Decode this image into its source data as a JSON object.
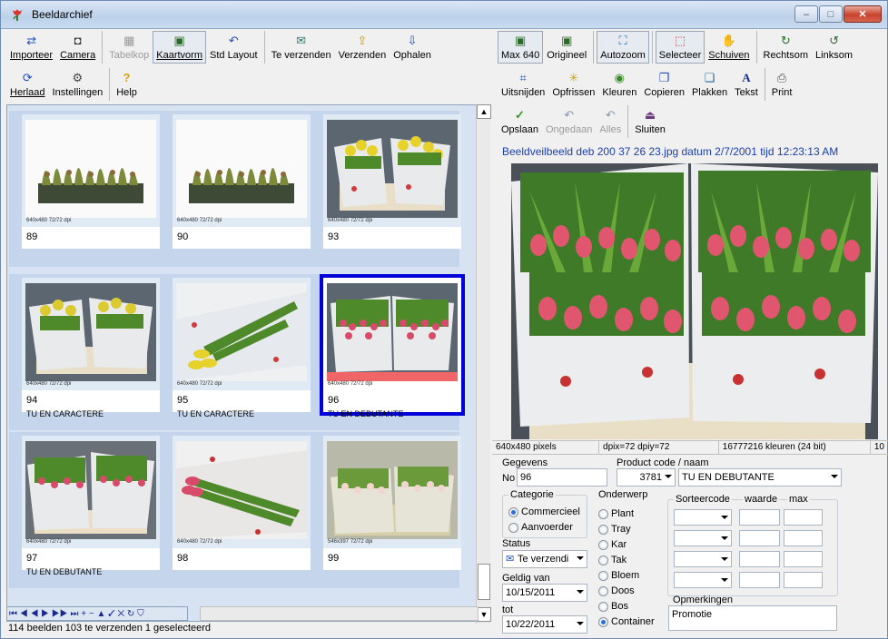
{
  "window": {
    "title": "Beeldarchief",
    "minimize": "–",
    "maximize": "□",
    "close": "✕"
  },
  "left_toolbar_row1": [
    {
      "label": "Importeer",
      "icon": "import-icon",
      "glyph": "⇄"
    },
    {
      "label": "Camera",
      "icon": "camera-icon",
      "glyph": "◘"
    },
    {
      "label": "Tabelkop",
      "icon": "table-icon",
      "glyph": "▦"
    },
    {
      "label": "Kaartvorm",
      "icon": "card-view-icon",
      "glyph": "▣"
    },
    {
      "label": "Std Layout",
      "icon": "undo-layout-icon",
      "glyph": "↶"
    },
    {
      "label": "Te verzenden",
      "icon": "to-send-icon",
      "glyph": "✉"
    },
    {
      "label": "Verzenden",
      "icon": "send-icon",
      "glyph": "⇪"
    },
    {
      "label": "Ophalen",
      "icon": "fetch-icon",
      "glyph": "⇩"
    }
  ],
  "left_toolbar_row2": [
    {
      "label": "Herlaad",
      "icon": "reload-icon",
      "glyph": "⟳"
    },
    {
      "label": "Instellingen",
      "icon": "settings-icon",
      "glyph": "⚙"
    },
    {
      "label": "Help",
      "icon": "help-icon",
      "glyph": "?"
    }
  ],
  "thumbnails": [
    {
      "dim": "640x480 72/72 dpi",
      "num": "89",
      "name": ""
    },
    {
      "dim": "640x480 72/72 dpi",
      "num": "90",
      "name": ""
    },
    {
      "dim": "640x480 72/72 dpi",
      "num": "93",
      "name": ""
    },
    {
      "dim": "640x480 72/72 dpi",
      "num": "94",
      "name": "TU EN CARACTERE"
    },
    {
      "dim": "640x480 72/72 dpi",
      "num": "95",
      "name": "TU EN CARACTERE"
    },
    {
      "dim": "640x480 72/72 dpi",
      "num": "96",
      "name": "TU EN DEBUTANTE"
    },
    {
      "dim": "640x480 72/72 dpi",
      "num": "97",
      "name": "TU EN DEBUTANTE"
    },
    {
      "dim": "640x480 72/72 dpi",
      "num": "98",
      "name": ""
    },
    {
      "dim": "546x397 72/72 dpi",
      "num": "99",
      "name": ""
    }
  ],
  "navigator": {
    "buttons": "⏮ ◀ ◀ ▶ ▶▶ ⏭ + − ▲ ✓ ✕ ↻ ⛉"
  },
  "status_text": "114 beelden  103 te verzenden  1 geselecteerd",
  "right_toolbar_row1": [
    {
      "label": "Max 640",
      "icon": "max-size-icon",
      "glyph": "▣"
    },
    {
      "label": "Origineel",
      "icon": "original-size-icon",
      "glyph": "▣"
    },
    {
      "label": "Autozoom",
      "icon": "autozoom-icon",
      "glyph": "⛶"
    },
    {
      "label": "Selecteer",
      "icon": "select-icon",
      "glyph": "⬚"
    },
    {
      "label": "Schuiven",
      "icon": "hand-icon",
      "glyph": "✋"
    },
    {
      "label": "Rechtsom",
      "icon": "rotate-right-icon",
      "glyph": "↻"
    },
    {
      "label": "Linksom",
      "icon": "rotate-left-icon",
      "glyph": "↺"
    }
  ],
  "right_toolbar_row2": [
    {
      "label": "Uitsnijden",
      "icon": "crop-icon",
      "glyph": "⌗"
    },
    {
      "label": "Opfrissen",
      "icon": "sparkle-icon",
      "glyph": "✳"
    },
    {
      "label": "Kleuren",
      "icon": "colors-icon",
      "glyph": "◉"
    },
    {
      "label": "Copieren",
      "icon": "copy-icon",
      "glyph": "❐"
    },
    {
      "label": "Plakken",
      "icon": "paste-icon",
      "glyph": "❏"
    },
    {
      "label": "Tekst",
      "icon": "text-icon",
      "glyph": "A"
    },
    {
      "label": "Print",
      "icon": "print-icon",
      "glyph": "⎙"
    }
  ],
  "right_toolbar_row3": [
    {
      "label": "Opslaan",
      "icon": "check-icon",
      "glyph": "✓"
    },
    {
      "label": "Ongedaan",
      "icon": "undo-icon",
      "glyph": "↶"
    },
    {
      "label": "Alles",
      "icon": "undo-all-icon",
      "glyph": "↶"
    },
    {
      "label": "Sluiten",
      "icon": "exit-icon",
      "glyph": "⏏"
    }
  ],
  "caption": "Beeldveilbeeld  deb 200 37 26 23.jpg  datum 2/7/2001    tijd 12:23:13 AM",
  "info": {
    "pixels": "640x480 pixels",
    "dpi": "dpix=72 dpiy=72",
    "colors": "16777216 kleuren (24 bit)",
    "extra": "10"
  },
  "form": {
    "gegevens_label": "Gegevens",
    "product_label": "Product code / naam",
    "no_label": "No",
    "no_value": "96",
    "code_value": "3781",
    "name_value": "TU EN DEBUTANTE",
    "categorie_label": "Categorie",
    "categorie_options": [
      "Commercieel",
      "Aanvoerder"
    ],
    "categorie_selected": 0,
    "status_label": "Status",
    "status_value": "Te verzendi",
    "geldig_label": "Geldig van",
    "geldig_value": "10/15/2011",
    "tot_label": "tot",
    "tot_value": "10/22/2011",
    "onderwerp_label": "Onderwerp",
    "onderwerp_options": [
      "Plant",
      "Tray",
      "Kar",
      "Tak",
      "Bloem",
      "Doos",
      "Bos",
      "Container"
    ],
    "onderwerp_selected": 7,
    "sorteercode_label": "Sorteercode",
    "waarde_label": "waarde",
    "max_label": "max",
    "opmerkingen_label": "Opmerkingen",
    "opmerkingen_value": "Promotie"
  }
}
